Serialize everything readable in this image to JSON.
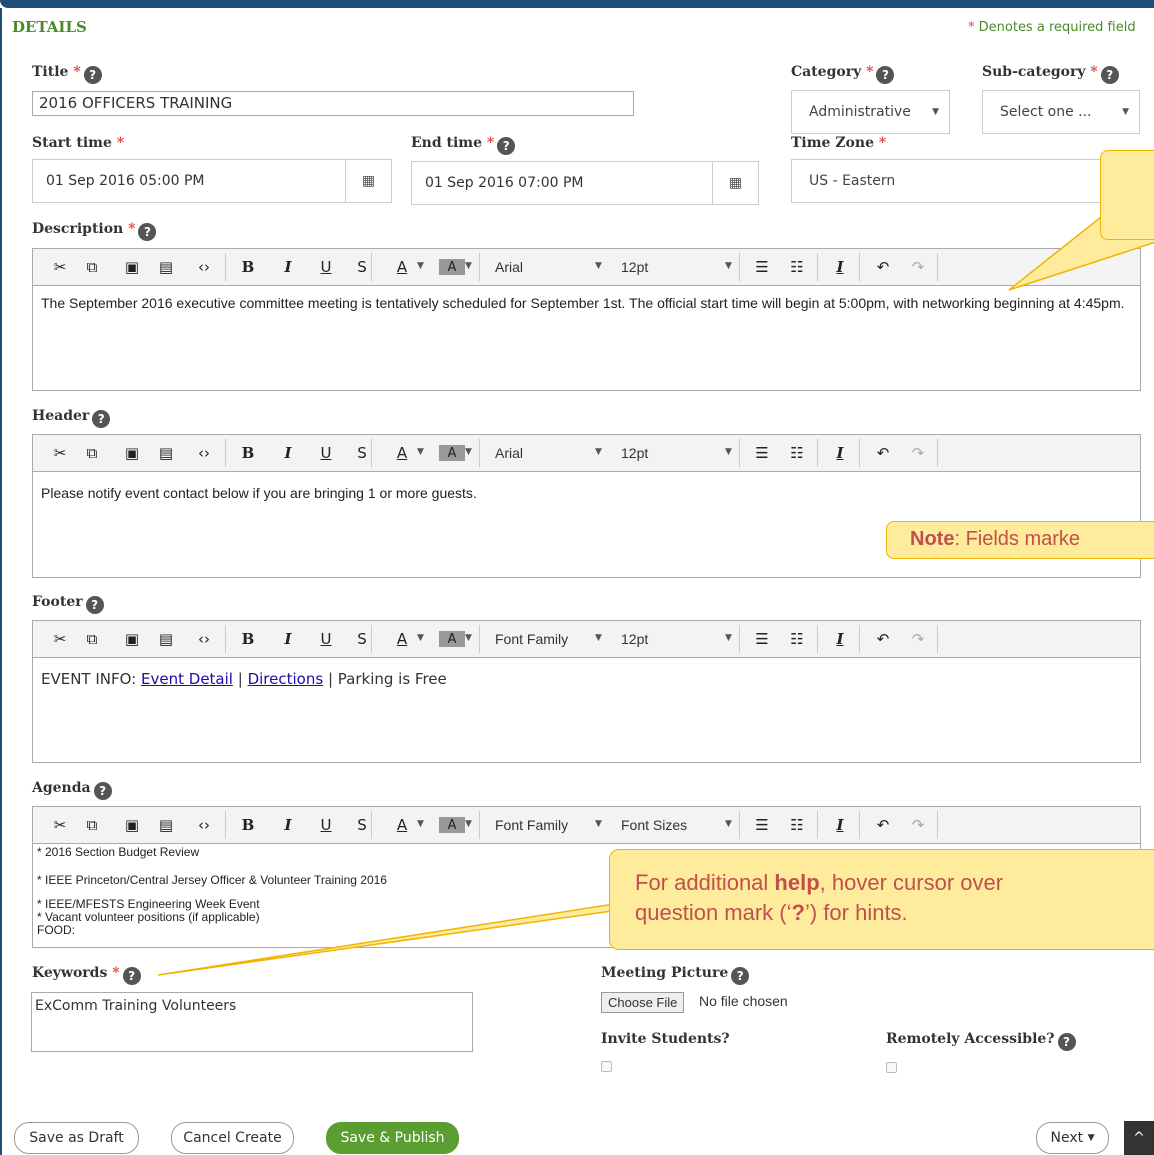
{
  "section": {
    "title": "DETAILS",
    "required_note": "Denotes a required field",
    "required_star": "*"
  },
  "title": {
    "label": "Title",
    "value": "2016 OFFICERS TRAINING"
  },
  "category": {
    "label": "Category",
    "value": "Administrative"
  },
  "subcategory": {
    "label": "Sub-category",
    "value": "Select one ..."
  },
  "start_time": {
    "label": "Start time",
    "value": "01 Sep 2016 05:00 PM"
  },
  "end_time": {
    "label": "End time",
    "value": "01 Sep 2016 07:00 PM"
  },
  "timezone": {
    "label": "Time Zone",
    "value": "US - Eastern"
  },
  "description": {
    "label": "Description",
    "font": "Arial",
    "size": "12pt",
    "text": "The September 2016 executive committee meeting is tentatively scheduled for September 1st. The official start time will begin at 5:00pm, with networking beginning at 4:45pm."
  },
  "header": {
    "label": "Header",
    "font": "Arial",
    "size": "12pt",
    "text": "Please notify event contact below if you are bringing 1 or more guests."
  },
  "footer": {
    "label": "Footer",
    "font": "Font Family",
    "size": "12pt",
    "prefix": "EVENT INFO:",
    "link1": "Event Detail",
    "sep": "|",
    "link2": "Directions",
    "suffix": "| Parking is Free"
  },
  "agenda": {
    "label": "Agenda",
    "font": "Font Family",
    "size": "Font Sizes",
    "lines": [
      "* 2016 Section Budget Review",
      "*  IEEE Princeton/Central Jersey Officer & Volunteer Training 2016",
      "* IEEE/MFESTS Engineering Week Event",
      "* Vacant volunteer positions (if applicable)",
      "FOOD:"
    ]
  },
  "keywords": {
    "label": "Keywords",
    "value": "ExComm Training Volunteers"
  },
  "meeting_picture": {
    "label": "Meeting Picture",
    "button": "Choose File",
    "status": "No file chosen"
  },
  "invite_students": {
    "label": "Invite Students?"
  },
  "remote": {
    "label": "Remotely Accessible?"
  },
  "buttons": {
    "draft": "Save as Draft",
    "cancel": "Cancel Create",
    "publish": "Save & Publish",
    "next": "Next"
  },
  "callout_note": {
    "bold": "Note",
    "text": ": Fields marke"
  },
  "callout_help": {
    "pre": "For additional ",
    "bold": "help",
    "mid": ", hover cursor over",
    "line2a": "question mark (‘",
    "q": "?",
    "line2b": "’) for hints."
  },
  "help_glyph": "?",
  "colors": {
    "section_green": "#4a8a2a",
    "required_red": "#e0463b",
    "publish_green": "#5a9e32",
    "callout_fill": "#ffeb9c",
    "callout_text": "#c0504d"
  }
}
